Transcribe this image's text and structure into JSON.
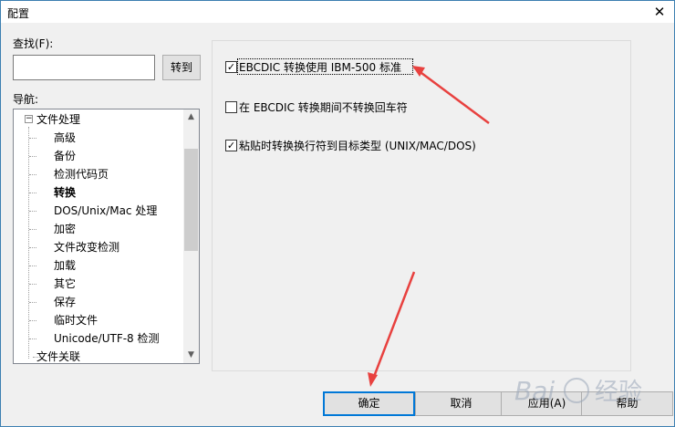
{
  "window": {
    "title": "配置",
    "close_glyph": "✕"
  },
  "find": {
    "label": "查找(F):",
    "value": "",
    "goto_label": "转到"
  },
  "nav": {
    "label": "导航:",
    "items": [
      {
        "label": "文件处理",
        "level": 0,
        "bold": false
      },
      {
        "label": "高级",
        "level": 1,
        "bold": false
      },
      {
        "label": "备份",
        "level": 1,
        "bold": false
      },
      {
        "label": "检测代码页",
        "level": 1,
        "bold": false
      },
      {
        "label": "转换",
        "level": 1,
        "bold": true
      },
      {
        "label": "DOS/Unix/Mac 处理",
        "level": 1,
        "bold": false
      },
      {
        "label": "加密",
        "level": 1,
        "bold": false
      },
      {
        "label": "文件改变检测",
        "level": 1,
        "bold": false
      },
      {
        "label": "加载",
        "level": 1,
        "bold": false
      },
      {
        "label": "其它",
        "level": 1,
        "bold": false
      },
      {
        "label": "保存",
        "level": 1,
        "bold": false
      },
      {
        "label": "临时文件",
        "level": 1,
        "bold": false
      },
      {
        "label": "Unicode/UTF-8 检测",
        "level": 1,
        "bold": false
      },
      {
        "label": "文件关联",
        "level": 0,
        "bold": false
      }
    ]
  },
  "options": [
    {
      "label": "EBCDIC 转换使用 IBM-500 标准",
      "checked": true
    },
    {
      "label": "在 EBCDIC 转换期间不转换回车符",
      "checked": false
    },
    {
      "label": "粘贴时转换换行符到目标类型 (UNIX/MAC/DOS)",
      "checked": true
    }
  ],
  "buttons": {
    "ok": "确定",
    "cancel": "取消",
    "apply": "应用(A)",
    "help": "帮助"
  },
  "colors": {
    "annotation_arrow": "#e8413f",
    "focus_border": "#0078d7"
  }
}
